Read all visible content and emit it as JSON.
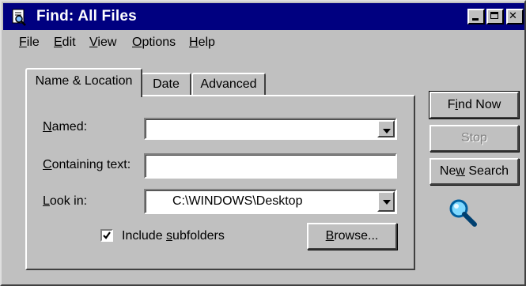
{
  "window": {
    "title": "Find: All Files",
    "icons": {
      "app": "find-files-icon",
      "minimize": "minimize-icon",
      "maximize": "maximize-icon",
      "close": "close-icon"
    }
  },
  "menu": [
    {
      "pre": "",
      "key": "F",
      "post": "ile"
    },
    {
      "pre": "",
      "key": "E",
      "post": "dit"
    },
    {
      "pre": "",
      "key": "V",
      "post": "iew"
    },
    {
      "pre": "",
      "key": "O",
      "post": "ptions"
    },
    {
      "pre": "",
      "key": "H",
      "post": "elp"
    }
  ],
  "tabs": [
    {
      "label": "Name & Location",
      "active": true
    },
    {
      "label": "Date",
      "active": false
    },
    {
      "label": "Advanced",
      "active": false
    }
  ],
  "form": {
    "named": {
      "pre": "",
      "key": "N",
      "post": "amed:",
      "value": ""
    },
    "containing": {
      "pre": "",
      "key": "C",
      "post": "ontaining text:",
      "value": ""
    },
    "look_in": {
      "pre": "",
      "key": "L",
      "post": "ook in:",
      "value": "C:\\WINDOWS\\Desktop"
    },
    "include_subfolders": {
      "pre": "Include ",
      "key": "s",
      "post": "ubfolders",
      "checked": true
    },
    "browse": {
      "pre": "",
      "key": "B",
      "post": "rowse..."
    }
  },
  "actions": {
    "find_now": {
      "pre": "F",
      "key": "i",
      "post": "nd Now"
    },
    "stop": {
      "label": "Stop"
    },
    "new_search": {
      "pre": "Ne",
      "key": "w",
      "post": " Search"
    },
    "magnifier_icon": "magnifying-glass-icon"
  }
}
